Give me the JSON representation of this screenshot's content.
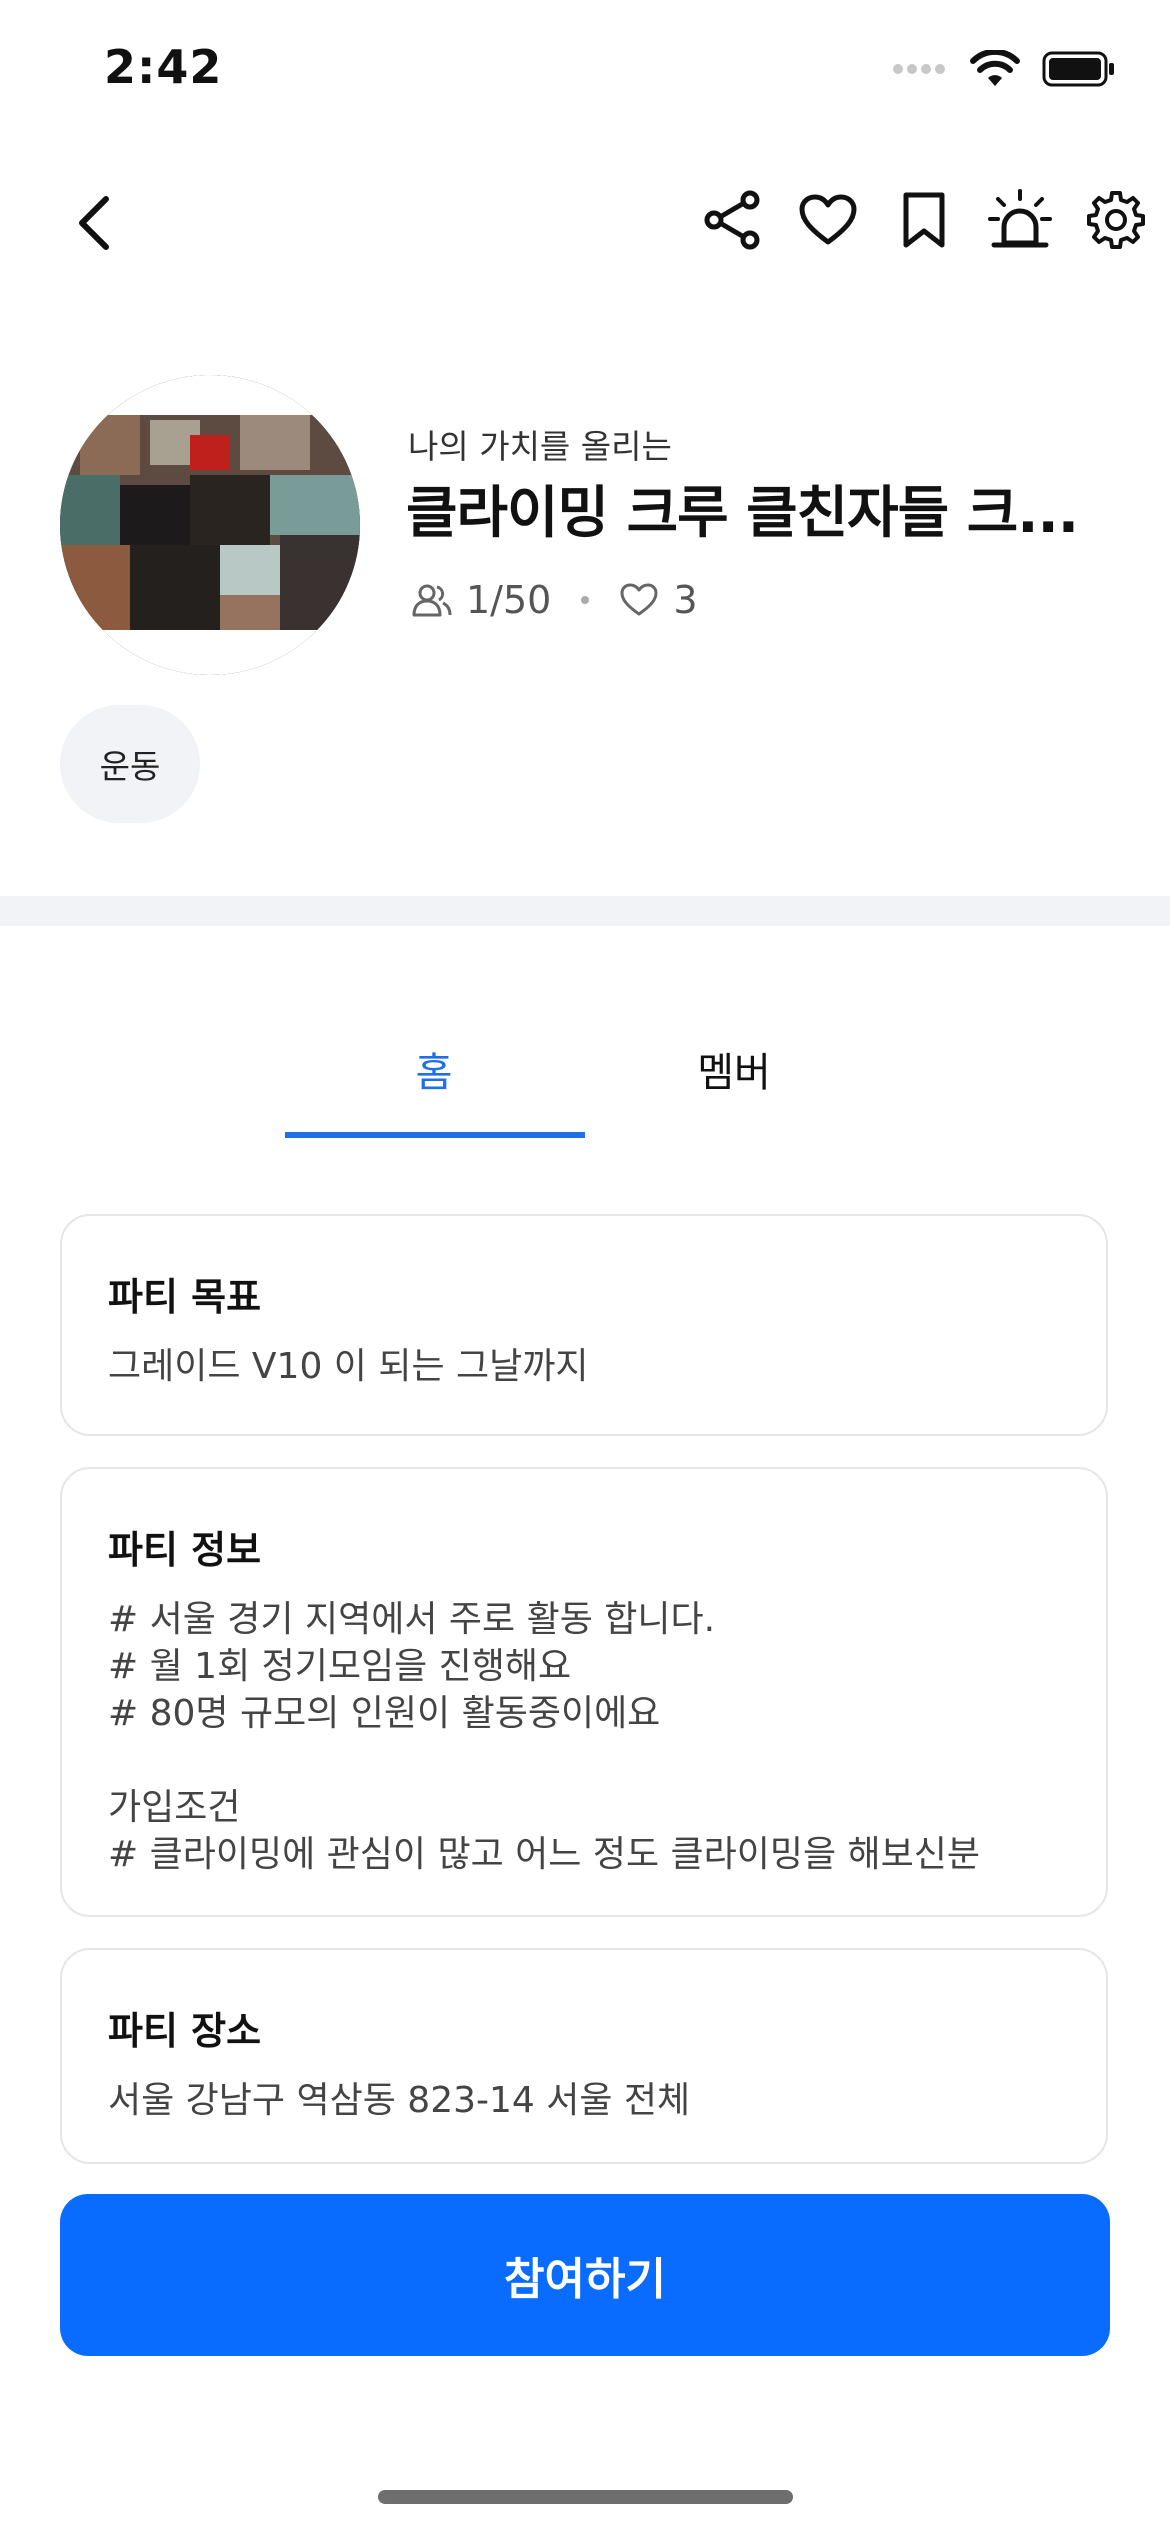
{
  "status_bar": {
    "time": "2:42"
  },
  "nav": {
    "icons": [
      "back-icon",
      "share-icon",
      "heart-icon",
      "bookmark-icon",
      "siren-icon",
      "gear-icon"
    ]
  },
  "party": {
    "subtitle": "나의 가치를 올리는",
    "title": "클라이밍 크루 클친자들 크...",
    "members": "1/50",
    "likes": "3",
    "tag": "운동"
  },
  "tabs": [
    {
      "label": "홈",
      "active": true
    },
    {
      "label": "멤버",
      "active": false
    }
  ],
  "cards": {
    "goal": {
      "title": "파티 목표",
      "body": "그레이드 V10 이 되는 그날까지"
    },
    "info": {
      "title": "파티 정보",
      "body": "# 서울 경기 지역에서 주로 활동 합니다.\n# 월 1회 정기모임을 진행해요\n# 80명 규모의 인원이 활동중이에요\n\n가입조건\n# 클라이밍에 관심이 많고 어느 정도 클라이밍을 해보신분"
    },
    "location": {
      "title": "파티 장소",
      "body": "서울 강남구 역삼동 823-14 서울 전체"
    }
  },
  "join_button": {
    "label": "참여하기"
  },
  "colors": {
    "accent": "#1f6fe8",
    "button": "#0a6cff",
    "divider": "#f2f3f6"
  }
}
